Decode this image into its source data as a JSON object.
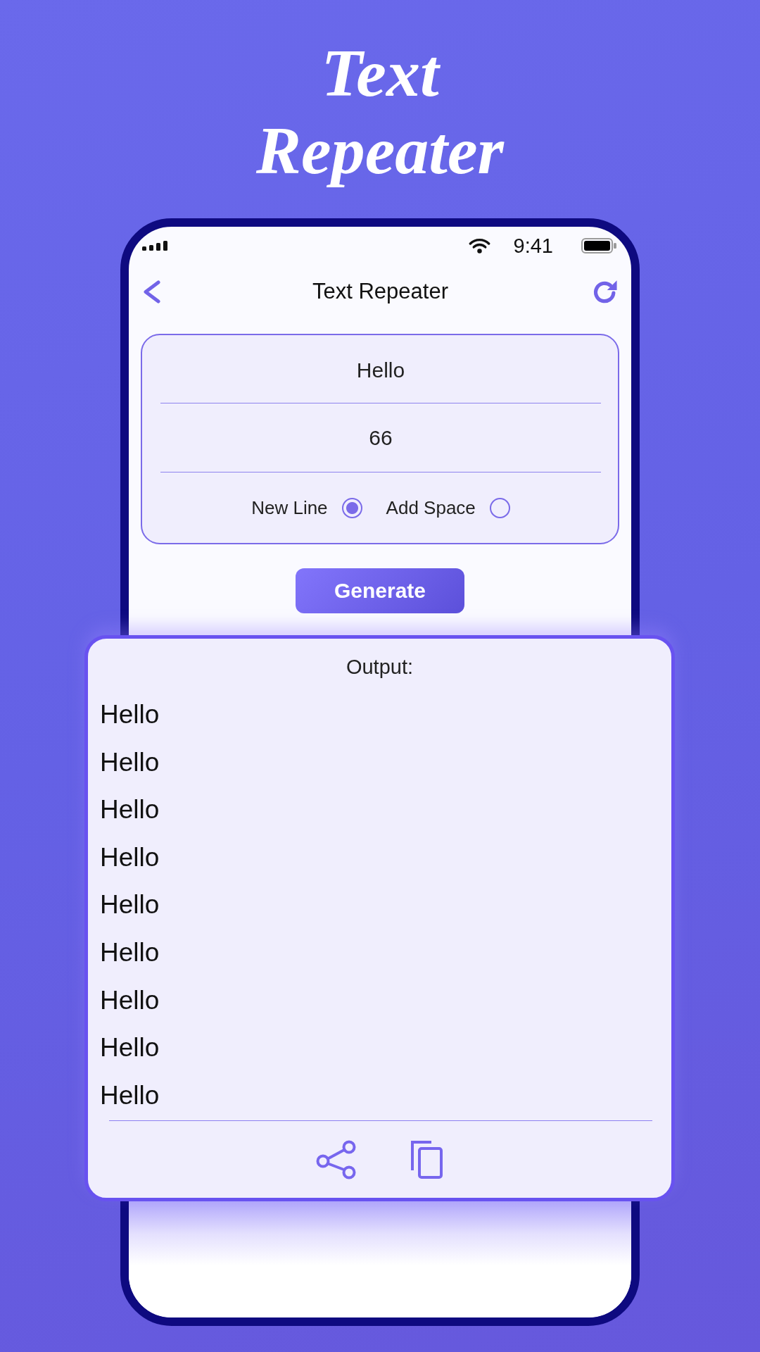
{
  "headline": "Text Repeater",
  "status_bar": {
    "time": "9:41"
  },
  "nav": {
    "title": "Text Repeater"
  },
  "form": {
    "text_value": "Hello",
    "count_value": "66",
    "options": [
      {
        "label": "New Line",
        "selected": true
      },
      {
        "label": "Add Space",
        "selected": false
      }
    ]
  },
  "generate_button": {
    "label": "Generate"
  },
  "output": {
    "label": "Output:",
    "lines": [
      "Hello",
      "Hello",
      "Hello",
      "Hello",
      "Hello",
      "Hello",
      "Hello",
      "Hello",
      "Hello"
    ]
  }
}
